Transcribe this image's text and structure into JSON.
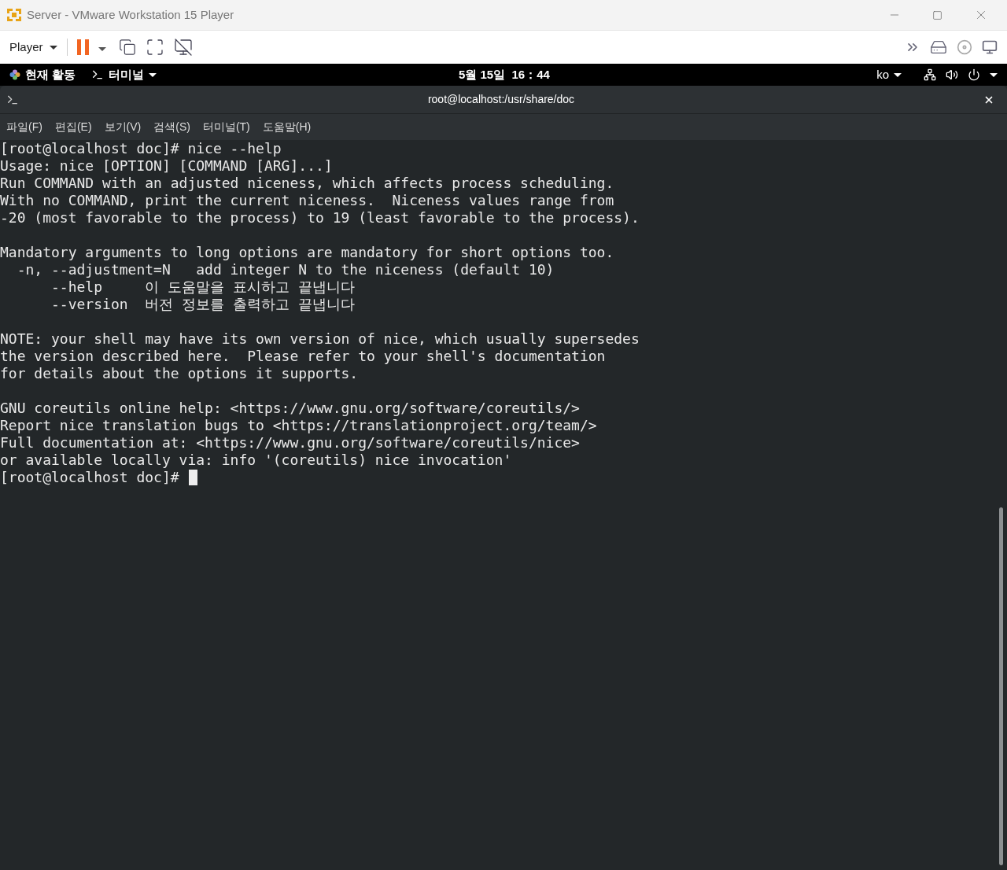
{
  "window": {
    "title": "Server - VMware Workstation 15 Player"
  },
  "toolbar": {
    "player_menu": "Player"
  },
  "top_bar": {
    "activities": "현재 활동",
    "app_menu": "터미널",
    "clock": "5월 15일  16：44",
    "input_method": "ko"
  },
  "terminal": {
    "title": "root@localhost:/usr/share/doc",
    "menu": [
      "파일(F)",
      "편집(E)",
      "보기(V)",
      "검색(S)",
      "터미널(T)",
      "도움말(H)"
    ],
    "paragraphs": [
      [
        "[root@localhost doc]# nice --help",
        "Usage: nice [OPTION] [COMMAND [ARG]...]",
        "Run COMMAND with an adjusted niceness, which affects process scheduling.",
        "With no COMMAND, print the current niceness.  Niceness values range from",
        "-20 (most favorable to the process) to 19 (least favorable to the process)."
      ],
      [
        "Mandatory arguments to long options are mandatory for short options too.",
        "  -n, --adjustment=N   add integer N to the niceness (default 10)",
        "      --help     이 도움말을 표시하고 끝냅니다",
        "      --version  버전 정보를 출력하고 끝냅니다"
      ],
      [
        "NOTE: your shell may have its own version of nice, which usually supersedes",
        "the version described here.  Please refer to your shell's documentation",
        "for details about the options it supports."
      ],
      [
        "GNU coreutils online help: <https://www.gnu.org/software/coreutils/>",
        "Report nice translation bugs to <https://translationproject.org/team/>",
        "Full documentation at: <https://www.gnu.org/software/coreutils/nice>",
        "or available locally via: info '(coreutils) nice invocation'",
        "[root@localhost doc]#"
      ]
    ],
    "cursor_visible": true
  }
}
